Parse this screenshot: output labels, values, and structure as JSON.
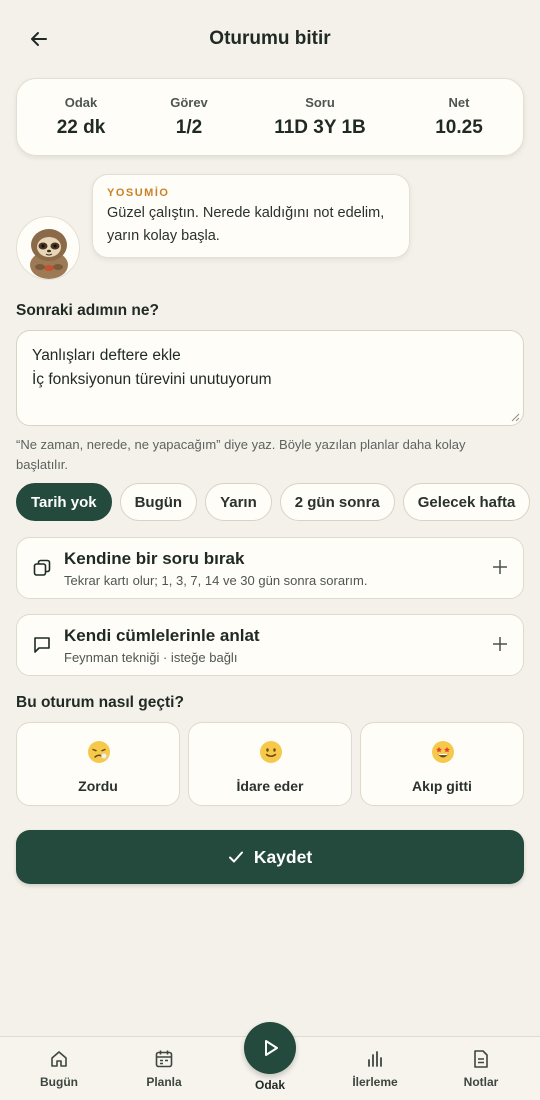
{
  "header": {
    "title": "Oturumu bitir"
  },
  "stats": [
    {
      "label": "Odak",
      "value": "22 dk"
    },
    {
      "label": "Görev",
      "value": "1/2"
    },
    {
      "label": "Soru",
      "value": "11D 3Y 1B"
    },
    {
      "label": "Net",
      "value": "10.25"
    }
  ],
  "mascot": {
    "name": "YOSUMİO",
    "message_line1": "Güzel çalıştın. Nerede kaldığını not edelim,",
    "message_line2": "yarın kolay başla."
  },
  "next_step": {
    "title": "Sonraki adımın ne?",
    "note_line1": "Yanlışları deftere ekle",
    "note_line2": "İç fonksiyonun türevini unutuyorum",
    "hint_line1": "“Ne zaman, nerede, ne yapacağım” diye yaz. Böyle yazılan planlar daha kolay",
    "hint_line2": "başlatılır."
  },
  "date_chips": [
    "Tarih yok",
    "Bugün",
    "Yarın",
    "2 gün sonra",
    "Gelecek hafta"
  ],
  "selected_chip": "Tarih yok",
  "options": [
    {
      "title": "Kendine bir soru bırak",
      "subtitle": "Tekrar kartı olur; 1, 3, 7, 14 ve 30 gün sonra sorarım.",
      "icon": "copy-icon"
    },
    {
      "title": "Kendi cümlelerinle anlat",
      "subtitle": "Feynman tekniği · isteğe bağlı",
      "icon": "chat-bubble-icon"
    }
  ],
  "mood": {
    "title": "Bu oturum nasıl geçti?",
    "options": [
      {
        "label": "Zordu",
        "icon": "tired-face-icon"
      },
      {
        "label": "İdare eder",
        "icon": "slight-smile-icon"
      },
      {
        "label": "Akıp gitti",
        "icon": "star-struck-icon"
      }
    ]
  },
  "save_button": {
    "label": "Kaydet"
  },
  "tabs": [
    {
      "label": "Bugün",
      "icon": "home-icon"
    },
    {
      "label": "Planla",
      "icon": "calendar-icon"
    },
    {
      "label": "Odak",
      "icon": "play-icon"
    },
    {
      "label": "İlerleme",
      "icon": "bar-chart-icon"
    },
    {
      "label": "Notlar",
      "icon": "document-icon"
    }
  ],
  "colors": {
    "primary": "#234a3c",
    "background": "#f4f1ea",
    "card": "#fffdf7",
    "accent": "#c9822b"
  }
}
